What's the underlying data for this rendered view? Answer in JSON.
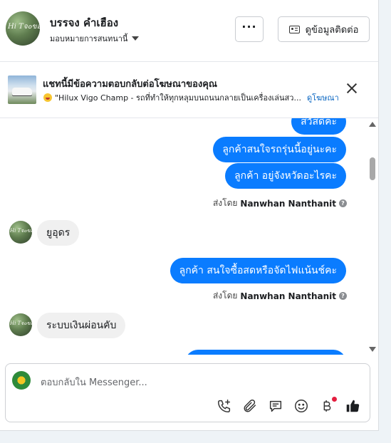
{
  "header": {
    "contact_name": "บรรจง คำเฮือง",
    "assign_label": "มอบหมายการสนทนานี้",
    "more_label": "···",
    "contact_info_label": "ดูข้อมูลติดต่อ",
    "avatar_text": "Hi Tจ๐ขอ"
  },
  "ad_banner": {
    "title": "แชทนี้มีข้อความตอบกลับต่อโฆษณาของคุณ",
    "quote": "\"Hilux Vigo Champ - รถที่ทำให้ทุกหลุมบนถนนกลายเป็นเครื่องเล่นสว...",
    "link": "ดูโฆษณา"
  },
  "messages": [
    {
      "direction": "out",
      "text": "สวัสดีค่ะ"
    },
    {
      "direction": "out",
      "text": "ลูกค้าสนใจรถรุ่นนี้อยู่นะคะ"
    },
    {
      "direction": "out",
      "text": "ลูกค้า อยู่จังหวัดอะไรคะ"
    },
    {
      "direction": "meta",
      "prefix": "ส่งโดย",
      "sender": "Nanwhan Nanthanit"
    },
    {
      "direction": "in",
      "text": "ยูอุดร"
    },
    {
      "direction": "out",
      "text": "ลูกค้า สนใจซื้อสดหรือจัดไฟแน้นช์คะ"
    },
    {
      "direction": "meta",
      "prefix": "ส่งโดย",
      "sender": "Nanwhan Nanthanit"
    },
    {
      "direction": "in",
      "text": "ระบบเงินผ่อนคับ"
    },
    {
      "direction": "out",
      "text": ""
    }
  ],
  "composer": {
    "placeholder": "ตอบกลับใน Messenger..."
  },
  "icons": [
    "dots-icon",
    "contact-card-icon",
    "close-icon",
    "help-icon",
    "call-icon",
    "attach-icon",
    "chat-bubble-icon",
    "emoji-icon",
    "baht-icon",
    "thumbs-up-icon"
  ],
  "colors": {
    "accent": "#0a7cff",
    "link": "#0a66c2",
    "badge": "#e41e3f"
  }
}
